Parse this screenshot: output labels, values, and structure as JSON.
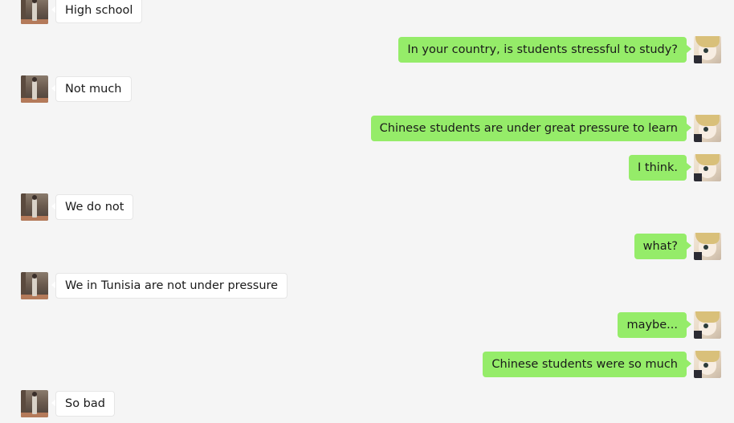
{
  "colors": {
    "background": "#f5f5f5",
    "outgoing_bubble": "#95ec69",
    "incoming_bubble": "#ffffff"
  },
  "messages": [
    {
      "sender": "contact",
      "text": "High school",
      "avatar": "contact-avatar"
    },
    {
      "sender": "me",
      "text": "In your country, is students stressful to study?",
      "avatar": "my-avatar"
    },
    {
      "sender": "contact",
      "text": "Not much",
      "avatar": "contact-avatar"
    },
    {
      "sender": "me",
      "text": "Chinese students are under great pressure to learn",
      "avatar": "my-avatar"
    },
    {
      "sender": "me",
      "text": "I think.",
      "avatar": "my-avatar"
    },
    {
      "sender": "contact",
      "text": "We do not",
      "avatar": "contact-avatar"
    },
    {
      "sender": "me",
      "text": "what?",
      "avatar": "my-avatar"
    },
    {
      "sender": "contact",
      "text": "We in Tunisia are not under pressure",
      "avatar": "contact-avatar"
    },
    {
      "sender": "me",
      "text": "maybe...",
      "avatar": "my-avatar"
    },
    {
      "sender": "me",
      "text": "Chinese students were so much",
      "avatar": "my-avatar"
    },
    {
      "sender": "contact",
      "text": "So bad",
      "avatar": "contact-avatar"
    }
  ]
}
